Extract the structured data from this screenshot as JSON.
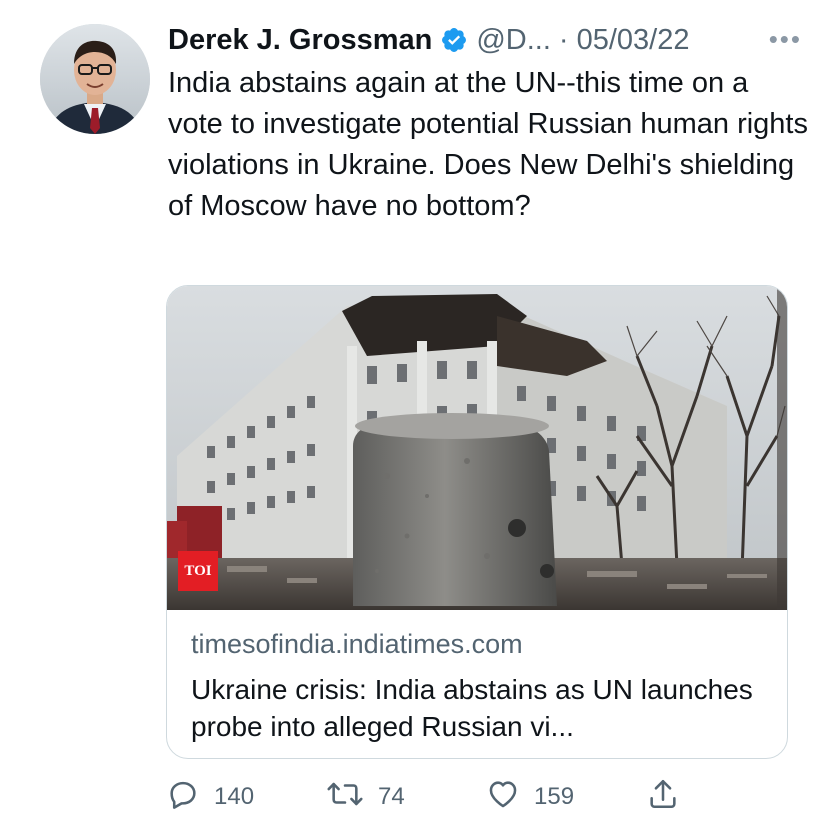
{
  "tweet": {
    "author_name": "Derek J. Grossman",
    "handle": "@D...",
    "separator": "·",
    "date": "05/03/22",
    "more": "•••",
    "text": "India abstains again at the UN--this time on a vote to investigate potential Russian human rights violations in Ukraine. Does New Delhi's shielding of Moscow have no bottom?"
  },
  "card": {
    "logo_text": "TOI",
    "domain": "timesofindia.indiatimes.com",
    "title": "Ukraine crisis: India abstains as UN launches probe into alleged Russian vi..."
  },
  "actions": {
    "replies": "140",
    "retweets": "74",
    "likes": "159"
  },
  "icons": {
    "verified": "verified-badge-icon",
    "reply": "reply-icon",
    "retweet": "retweet-icon",
    "like": "heart-icon",
    "share": "share-icon",
    "more": "more-icon"
  },
  "colors": {
    "verified": "#1d9bf0",
    "secondary_text": "#536471",
    "primary_text": "#0f1419",
    "toi_red": "#e31e24"
  }
}
